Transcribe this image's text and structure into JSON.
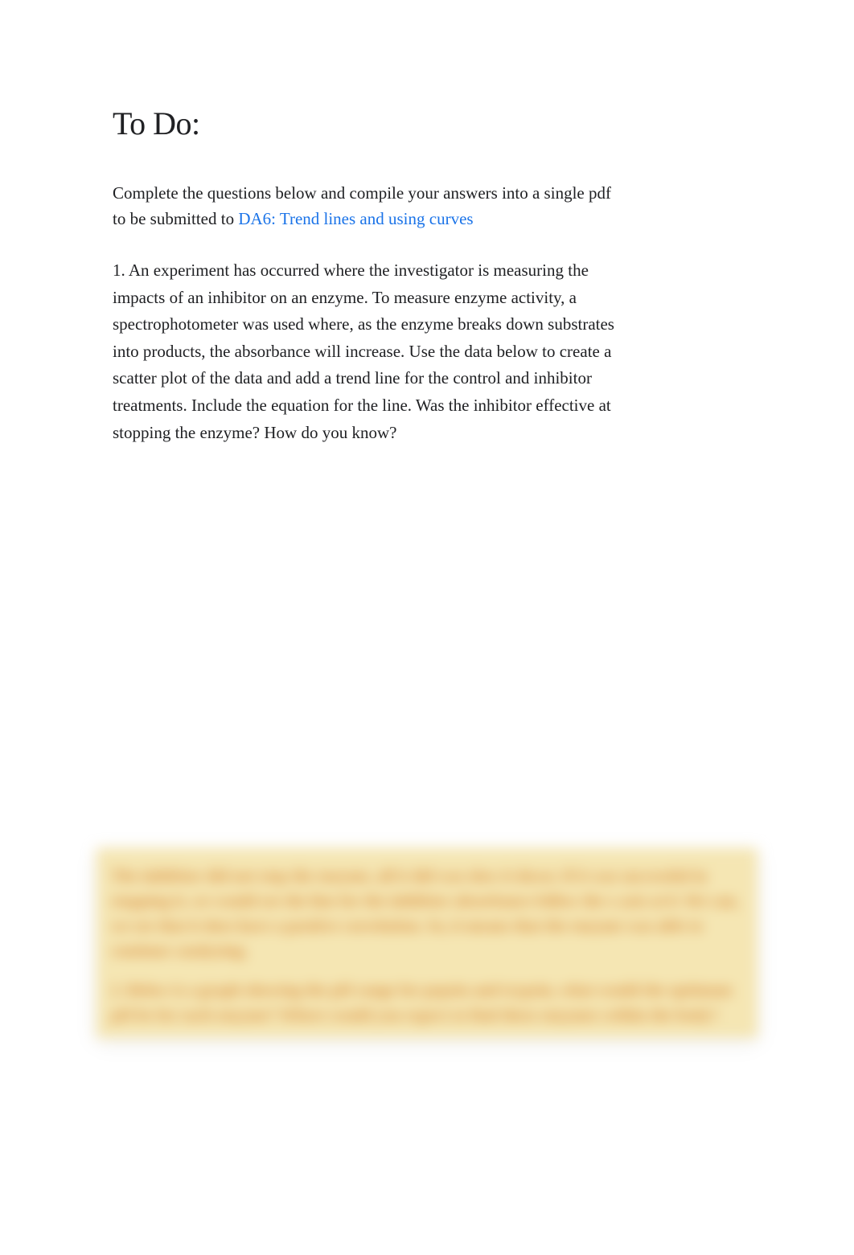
{
  "heading": "To Do:",
  "intro_prefix": "Complete the questions below and compile your answers into a single pdf to be submitted to   ",
  "link_text": "DA6: Trend lines and using curves",
  "question1_number": "1.   ",
  "question1_text": "An experiment has occurred where the investigator is measuring the impacts of an inhibitor on an enzyme. To measure enzyme activity, a spectrophotometer was used where, as the enzyme breaks down substrates into products, the absorbance will increase. Use the data below to create a scatter plot of the data and add a trend line for the control and inhibitor treatments. Include the equation for the line. Was the inhibitor effective at stopping the enzyme? How do you know?",
  "blurred_para1": "The inhibitor did not stop the enzyme, all it did was slow it down. If it was successful in stopping it, we would see the line for the inhibitor absorbance follow the x axis at 0. We can, we see that it does have a positive correlation. So, it means that the enzyme was able to continue catalyzing.",
  "blurred_para2": "2. Below is a graph showing the pH range for pepsin and trypsin, what would the optimum pH be for each enzyme? Where would you expect to find these enzymes within the body?"
}
